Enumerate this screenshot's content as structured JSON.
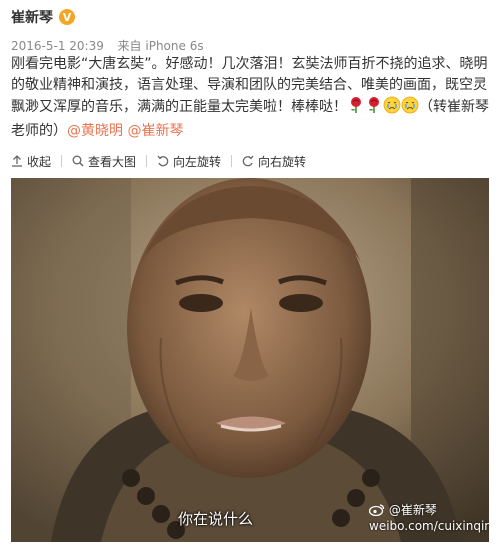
{
  "post": {
    "author": "崔新琴",
    "verified_badge": "V",
    "timestamp": "2016-5-1 20:39",
    "source_prefix": "来自",
    "source": "iPhone 6s",
    "text_main": "刚看完电影“大唐玄奘”。好感动！几次落泪！玄奘法师百折不挠的追求、晓明的敬业精神和演技，语言处理、导演和团队的完美结合、唯美的画面，既空灵飘渺又浑厚的音乐，满满的正能量太完美啦！棒棒哒！",
    "text_tail": "（转崔新琴老师的）",
    "mention_1": "@黄晓明",
    "mention_2": "@崔新琴",
    "emojis": [
      "rose-icon",
      "rose-icon",
      "crying-face-icon",
      "crying-face-icon"
    ]
  },
  "toolbar": {
    "collapse": "收起",
    "view_large": "查看大图",
    "rotate_left": "向左旋转",
    "rotate_right": "向右旋转"
  },
  "photo": {
    "subtitle": "你在说什么",
    "watermark_handle": "@崔新琴",
    "watermark_url": "weibo.com/cuixinqin"
  },
  "colors": {
    "link": "#eb7350",
    "badge": "#f5a623",
    "meta": "#888888"
  }
}
